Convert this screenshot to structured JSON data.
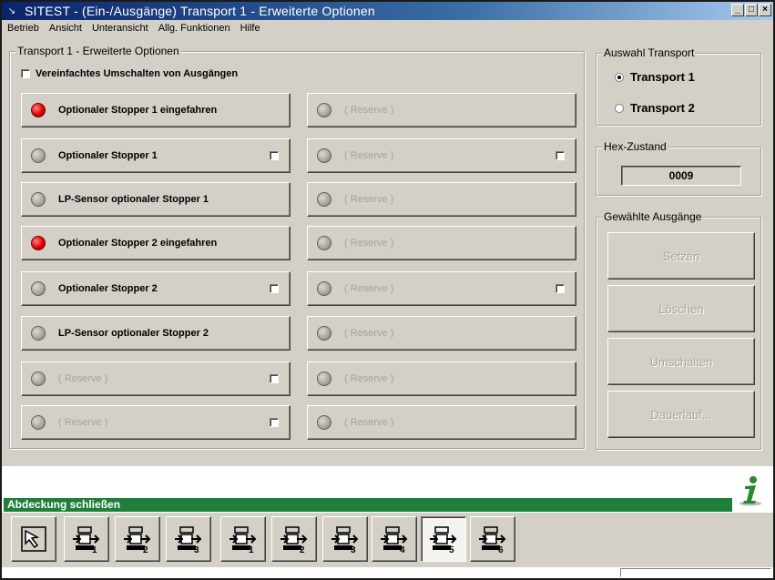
{
  "window": {
    "title": "SITEST - (Ein-/Ausgänge) Transport 1 - Erweiterte Optionen",
    "min_label": "_",
    "max_label": "□",
    "close_label": "×"
  },
  "menu": [
    "Betrieb",
    "Ansicht",
    "Unteransicht",
    "Allg. Funktionen",
    "Hilfe"
  ],
  "main_group": {
    "label": "Transport 1 - Erweiterte Optionen",
    "simplified_toggle": "Vereinfachtes Umschalten von Ausgängen",
    "left_items": [
      {
        "label": "Optionaler Stopper 1 eingefahren",
        "led": "red",
        "checkbox": false,
        "reserve": false
      },
      {
        "label": "Optionaler Stopper 1",
        "led": "grey",
        "checkbox": true,
        "reserve": false
      },
      {
        "label": "LP-Sensor optionaler Stopper 1",
        "led": "grey",
        "checkbox": false,
        "reserve": false
      },
      {
        "label": "Optionaler Stopper 2 eingefahren",
        "led": "red",
        "checkbox": false,
        "reserve": false
      },
      {
        "label": "Optionaler Stopper 2",
        "led": "grey",
        "checkbox": true,
        "reserve": false
      },
      {
        "label": "LP-Sensor optionaler Stopper 2",
        "led": "grey",
        "checkbox": false,
        "reserve": false
      },
      {
        "label": "( Reserve )",
        "led": "grey",
        "checkbox": true,
        "reserve": true
      },
      {
        "label": "( Reserve )",
        "led": "grey",
        "checkbox": true,
        "reserve": true
      }
    ],
    "right_items": [
      {
        "label": "( Reserve )",
        "led": "grey",
        "checkbox": false,
        "reserve": true
      },
      {
        "label": "( Reserve )",
        "led": "grey",
        "checkbox": true,
        "reserve": true
      },
      {
        "label": "( Reserve )",
        "led": "grey",
        "checkbox": false,
        "reserve": true
      },
      {
        "label": "( Reserve )",
        "led": "grey",
        "checkbox": false,
        "reserve": true
      },
      {
        "label": "( Reserve )",
        "led": "grey",
        "checkbox": true,
        "reserve": true
      },
      {
        "label": "( Reserve )",
        "led": "grey",
        "checkbox": false,
        "reserve": true
      },
      {
        "label": "( Reserve )",
        "led": "grey",
        "checkbox": false,
        "reserve": true
      },
      {
        "label": "( Reserve )",
        "led": "grey",
        "checkbox": false,
        "reserve": true
      }
    ]
  },
  "transport_group": {
    "label": "Auswahl Transport",
    "options": [
      "Transport 1",
      "Transport 2"
    ],
    "selected": "Transport 1"
  },
  "hex_group": {
    "label": "Hex-Zustand",
    "value": "0009"
  },
  "outputs_group": {
    "label": "Gewählte Ausgänge",
    "buttons": [
      "Setzen",
      "Löschen",
      "Umschalten",
      "Dauerlauf..."
    ]
  },
  "status": {
    "text": "Abdeckung schließen",
    "color": "#1e7f3a"
  },
  "toolbar": {
    "station_buttons": [
      {
        "name": "station-1",
        "number": "1"
      },
      {
        "name": "station-2",
        "number": "2"
      },
      {
        "name": "station-3",
        "number": "3"
      },
      {
        "name": "transport-1",
        "number": "1"
      },
      {
        "name": "transport-2",
        "number": "2"
      },
      {
        "name": "transport-3",
        "number": "3"
      },
      {
        "name": "transport-4",
        "number": "4"
      },
      {
        "name": "transport-5",
        "number": "5"
      },
      {
        "name": "transport-6",
        "number": "6"
      }
    ],
    "active_index": 7
  },
  "colors": {
    "led_on": "#e00000",
    "led_off": "#a8a49c",
    "titlebar_start": "#0a246a",
    "info_icon": "#2a8a2a"
  }
}
